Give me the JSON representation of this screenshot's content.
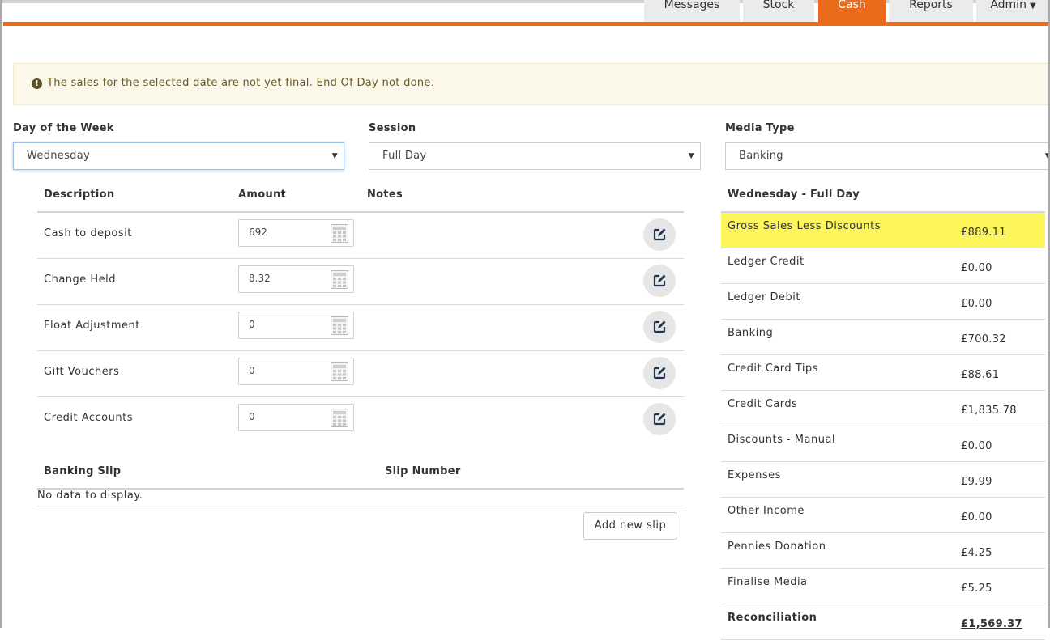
{
  "nav": {
    "tabs": [
      {
        "label": "Messages"
      },
      {
        "label": "Stock"
      },
      {
        "label": "Cash"
      },
      {
        "label": "Reports"
      },
      {
        "label": "Admin"
      }
    ],
    "active_tab": "Cash",
    "accent": "#ea6b1c"
  },
  "alert": {
    "text": "The sales for the selected date are not yet final. End Of Day not done.",
    "icon": "exclamation-circle-icon"
  },
  "filters": {
    "day_label": "Day of the Week",
    "day_value": "Wednesday",
    "session_label": "Session",
    "session_value": "Full Day",
    "media_label": "Media Type",
    "media_value": "Banking"
  },
  "cash_table": {
    "headers": {
      "description": "Description",
      "amount": "Amount",
      "notes": "Notes"
    },
    "rows": [
      {
        "description": "Cash to deposit",
        "amount": "692"
      },
      {
        "description": "Change Held",
        "amount": "8.32"
      },
      {
        "description": "Float Adjustment",
        "amount": "0"
      },
      {
        "description": "Gift Vouchers",
        "amount": "0"
      },
      {
        "description": "Credit Accounts",
        "amount": "0"
      }
    ]
  },
  "banking_slip": {
    "headers": {
      "slip": "Banking Slip",
      "number": "Slip Number"
    },
    "empty_text": "No data to display.",
    "add_button": "Add new slip"
  },
  "summary": {
    "title": "Wednesday - Full Day",
    "rows": [
      {
        "label": "Gross Sales Less Discounts",
        "value": "£889.11"
      },
      {
        "label": "Ledger Credit",
        "value": "£0.00"
      },
      {
        "label": "Ledger Debit",
        "value": "£0.00"
      },
      {
        "label": "Banking",
        "value": "£700.32"
      },
      {
        "label": "Credit Card Tips",
        "value": "£88.61"
      },
      {
        "label": "Credit Cards",
        "value": "£1,835.78"
      },
      {
        "label": "Discounts - Manual",
        "value": "£0.00"
      },
      {
        "label": "Expenses",
        "value": "£9.99"
      },
      {
        "label": "Other Income",
        "value": "£0.00"
      },
      {
        "label": "Pennies Donation",
        "value": "£4.25"
      },
      {
        "label": "Finalise Media",
        "value": "£5.25"
      },
      {
        "label": "Reconciliation",
        "value": "£1,569.37"
      }
    ],
    "highlight_color": "#fdf55c"
  }
}
